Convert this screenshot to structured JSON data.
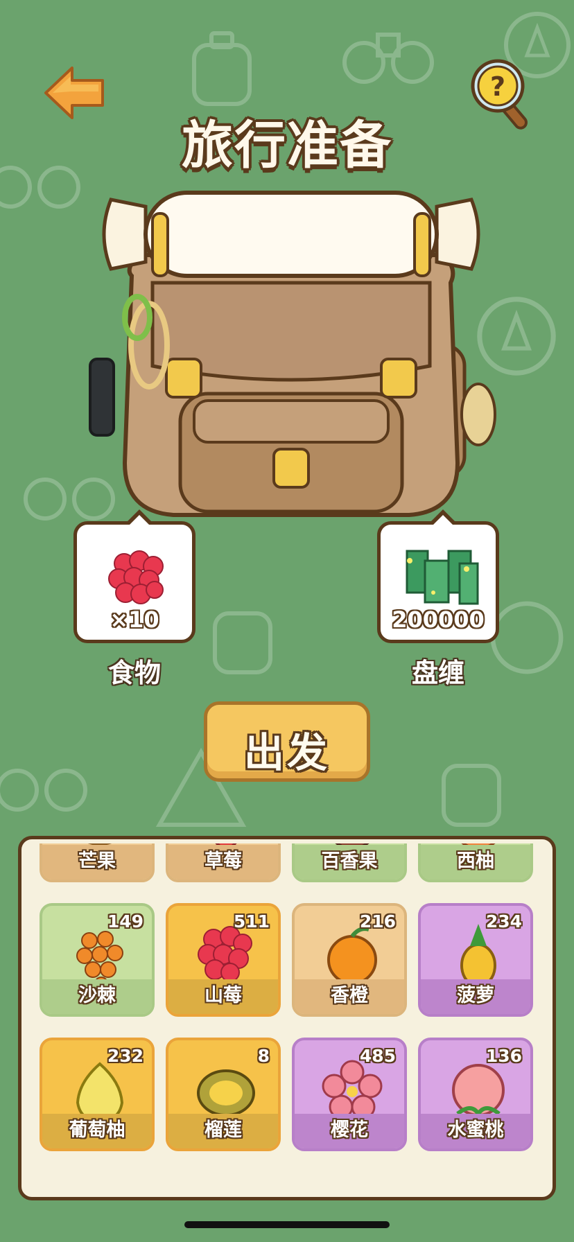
{
  "header": {
    "title": "旅行准备"
  },
  "slots": {
    "food": {
      "label": "食物",
      "count": "×10",
      "icon": "raspberry-icon"
    },
    "money": {
      "label": "盘缠",
      "count": "200000",
      "icon": "clover-money-icon"
    }
  },
  "depart_button": {
    "label": "出发"
  },
  "inventory": {
    "items": [
      {
        "name": "芒果",
        "qty": "",
        "icon": "mango-icon",
        "rarity": "tan"
      },
      {
        "name": "草莓",
        "qty": "",
        "icon": "strawberry-icon",
        "rarity": "tan"
      },
      {
        "name": "百香果",
        "qty": "",
        "icon": "passionfruit-icon",
        "rarity": "green"
      },
      {
        "name": "西柚",
        "qty": "",
        "icon": "grapefruit-icon",
        "rarity": "green"
      },
      {
        "name": "沙棘",
        "qty": "149",
        "icon": "sea-buckthorn-icon",
        "rarity": "green"
      },
      {
        "name": "山莓",
        "qty": "511",
        "icon": "raspberry-icon",
        "rarity": "gold"
      },
      {
        "name": "香橙",
        "qty": "216",
        "icon": "orange-icon",
        "rarity": "tan"
      },
      {
        "name": "菠萝",
        "qty": "234",
        "icon": "pineapple-icon",
        "rarity": "purple"
      },
      {
        "name": "葡萄柚",
        "qty": "232",
        "icon": "pomelo-icon",
        "rarity": "gold"
      },
      {
        "name": "榴莲",
        "qty": "8",
        "icon": "durian-icon",
        "rarity": "gold"
      },
      {
        "name": "樱花",
        "qty": "485",
        "icon": "sakura-icon",
        "rarity": "purple"
      },
      {
        "name": "水蜜桃",
        "qty": "136",
        "icon": "peach-icon",
        "rarity": "purple"
      }
    ]
  },
  "colors": {
    "background": "#6ba36d",
    "accent": "#f5c760",
    "outline": "#5a3a1c"
  }
}
